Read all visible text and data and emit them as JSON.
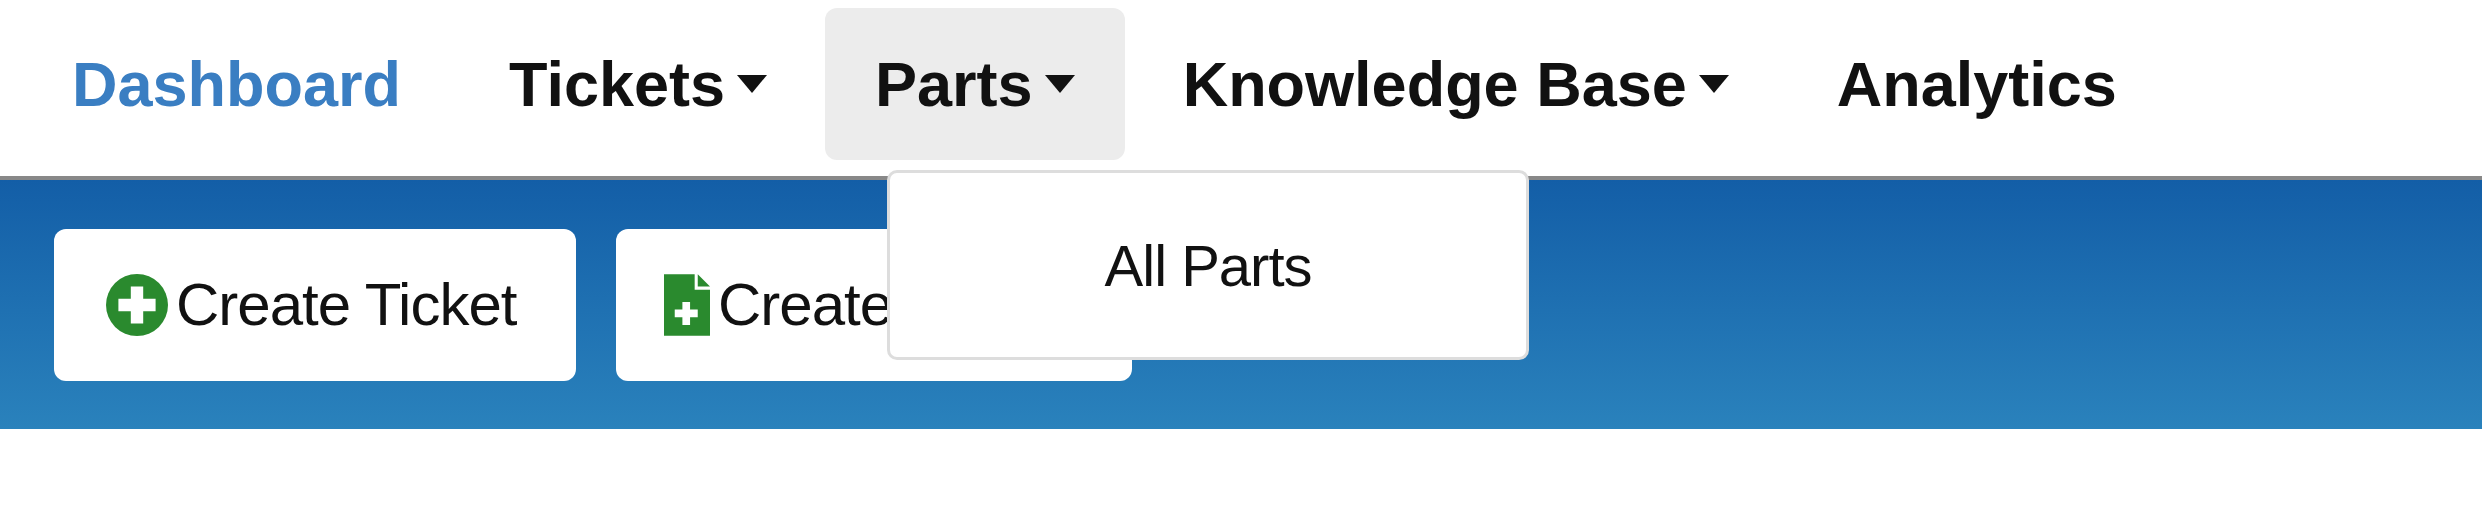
{
  "nav": {
    "items": [
      {
        "label": "Dashboard",
        "selected": true,
        "has_menu": false,
        "expanded": false
      },
      {
        "label": "Tickets",
        "selected": false,
        "has_menu": true,
        "expanded": false
      },
      {
        "label": "Parts",
        "selected": false,
        "has_menu": true,
        "expanded": true,
        "menu": [
          {
            "label": "All Parts"
          }
        ]
      },
      {
        "label": "Knowledge Base",
        "selected": false,
        "has_menu": true,
        "expanded": false
      },
      {
        "label": "Analytics",
        "selected": false,
        "has_menu": false,
        "expanded": false
      }
    ]
  },
  "actions": [
    {
      "label": "Create Ticket",
      "kind": "plus-circle"
    },
    {
      "label": "Create",
      "kind": "file-plus"
    }
  ]
}
